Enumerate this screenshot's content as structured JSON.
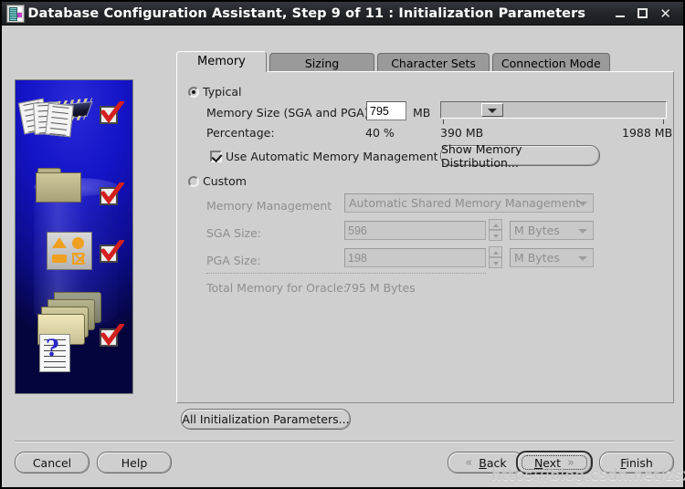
{
  "window": {
    "title": "Database Configuration Assistant, Step 9 of 11 : Initialization Parameters",
    "icon": "database-assistant-icon",
    "minimize_label": "_",
    "maximize_label": "□",
    "close_label": "✕"
  },
  "illustration": {
    "alt": "oracle-database-wizard-illustration",
    "check_marks": 4
  },
  "tabs": [
    {
      "label": "Memory",
      "active": true
    },
    {
      "label": "Sizing",
      "active": false
    },
    {
      "label": "Character Sets",
      "active": false
    },
    {
      "label": "Connection Mode",
      "active": false
    }
  ],
  "memory_tab": {
    "typical": {
      "label": "Typical",
      "selected": true,
      "memory_size_label": "Memory Size (SGA and PGA):",
      "memory_size_value": "795",
      "memory_size_unit": "MB",
      "slider": {
        "min_label": "390 MB",
        "max_label": "1988 MB",
        "thumb_percent": 25
      },
      "percentage_label": "Percentage:",
      "percentage_value": "40 %",
      "amm_checkbox_label": "Use Automatic Memory Management",
      "amm_checked": true,
      "show_memory_distribution_label": "Show Memory Distribution..."
    },
    "custom": {
      "label": "Custom",
      "selected": false,
      "memory_management_label": "Memory Management",
      "memory_management_value": "Automatic Shared Memory Management",
      "sga_label": "SGA Size:",
      "sga_value": "596",
      "sga_unit": "M Bytes",
      "pga_label": "PGA Size:",
      "pga_value": "198",
      "pga_unit": "M Bytes",
      "total_label": "Total Memory for Oracle:",
      "total_value": "795 M Bytes"
    }
  },
  "all_parameters_button": "All Initialization Parameters...",
  "footer": {
    "cancel": "Cancel",
    "help": "Help",
    "back": "Back",
    "back_mnemonic": "B",
    "next": "Next",
    "next_mnemonic": "N",
    "finish": "Finish",
    "finish_mnemonic": "F",
    "back_icon": "chevron-left-double-icon",
    "next_icon": "chevron-right-double-icon"
  },
  "watermark": "https://blog.csdn.net/zsx0728",
  "colors": {
    "window_bg": "#cfcfcf",
    "titlebar": "#23262a",
    "tab_inactive": "#9a9a9a",
    "illustration_blue": "#1414c8",
    "check_red": "#d41f1f",
    "disabled_text": "#8e8e8e"
  }
}
